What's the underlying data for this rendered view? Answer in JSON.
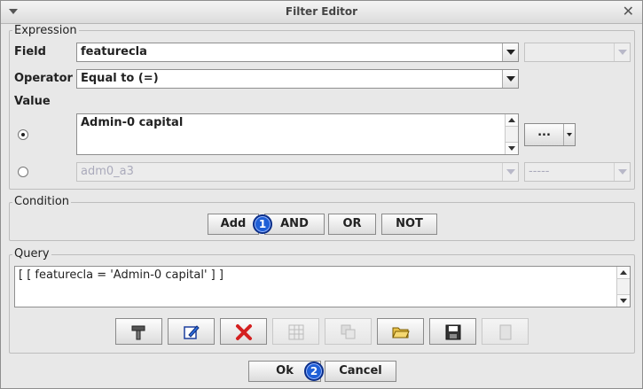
{
  "window": {
    "title": "Filter Editor"
  },
  "expression": {
    "group_label": "Expression",
    "field_label": "Field",
    "field_value": "featurecla",
    "field_extra_value": "",
    "operator_label": "Operator",
    "operator_value": "Equal to (=)",
    "value_label": "Value",
    "value_text": "Admin-0 capital",
    "value_more_button": "...",
    "field_ref_value": "adm0_a3",
    "field_ref_extra": "-----"
  },
  "condition": {
    "group_label": "Condition",
    "buttons": {
      "add": "Add",
      "and": "AND",
      "or": "OR",
      "not": "NOT"
    }
  },
  "query": {
    "group_label": "Query",
    "text": "[ [ featurecla  =  'Admin-0 capital' ] ]",
    "toolbar_icons": [
      "build-icon",
      "edit-icon",
      "delete-icon",
      "table-icon",
      "copy-icon",
      "open-folder-icon",
      "save-icon",
      "clear-icon"
    ]
  },
  "footer": {
    "ok": "Ok",
    "cancel": "Cancel"
  },
  "badges": {
    "one": "1",
    "two": "2"
  },
  "colors": {
    "badge": "#1f5fd6",
    "delete": "#d42020"
  }
}
